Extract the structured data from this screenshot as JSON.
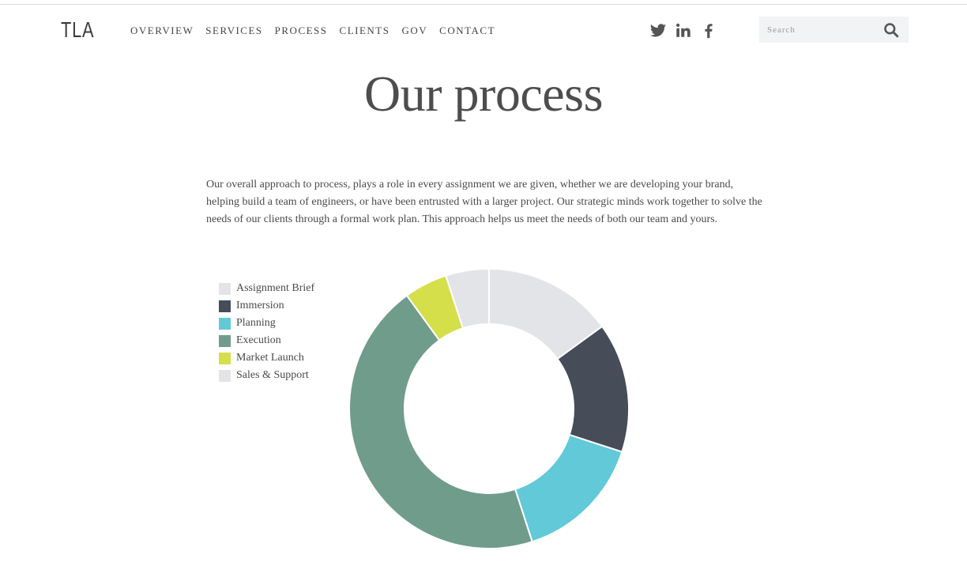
{
  "header": {
    "logo": "TLA",
    "nav": [
      "OVERVIEW",
      "SERVICES",
      "PROCESS",
      "CLIENTS",
      "GOV",
      "CONTACT"
    ],
    "social_icons": [
      "twitter-icon",
      "linkedin-icon",
      "facebook-icon"
    ],
    "search": {
      "placeholder": "Search",
      "icon": "search-icon"
    }
  },
  "main": {
    "title": "Our process",
    "intro": "Our overall approach to process, plays a role in every assignment we are given, whether we are developing your brand, helping build a team of engineers, or have been entrusted with a larger project. Our strategic minds work together to solve the needs of our clients through a formal work plan. This approach helps us meet the needs of both our team and yours."
  },
  "colors": {
    "assignment_brief": "#e3e4e8",
    "immersion": "#464c58",
    "planning": "#62c9d8",
    "execution": "#709c8c",
    "market_launch": "#d4df4a",
    "sales_support": "#e3e4e8"
  },
  "chart_data": {
    "type": "pie",
    "donut": true,
    "categories": [
      "Assignment Brief",
      "Immersion",
      "Planning",
      "Execution",
      "Market Launch",
      "Sales & Support"
    ],
    "values": [
      15,
      15,
      15,
      45,
      5,
      5
    ],
    "legend_position": "left"
  }
}
